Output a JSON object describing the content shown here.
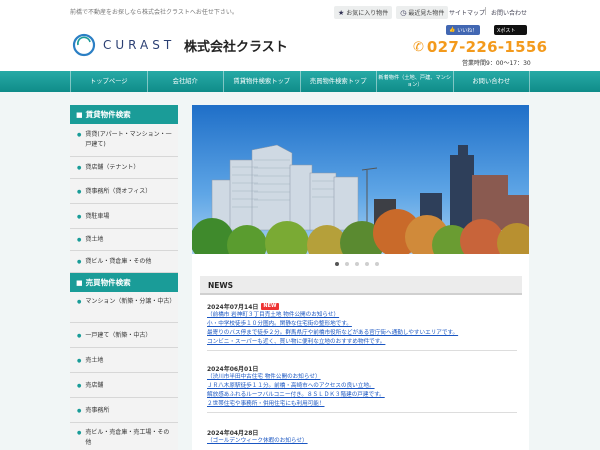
{
  "topbar": {
    "tagline": "前橋で不動産をお探しなら株式会社クラストへお任せ下さい。",
    "favorites": "お気に入り物件",
    "recent": "最近見た物件",
    "sitemap": "サイトマップ",
    "contact": "お問い合わせ"
  },
  "header": {
    "logo_en": "CURAST",
    "logo_jp": "株式会社クラスト",
    "facebook": "いいね！",
    "twitter": "Xポスト",
    "phone": "027-226-1556",
    "hours": "営業時間9：00～17：30"
  },
  "nav": [
    {
      "label": "トップページ"
    },
    {
      "label": "会社紹介"
    },
    {
      "label": "賃貸物件検索トップ"
    },
    {
      "label": "売買物件検索トップ"
    },
    {
      "label": "新着物件（土地、戸建、マンション）"
    },
    {
      "label": "お問い合わせ"
    }
  ],
  "sidebar": {
    "rental_title": "賃貸物件検索",
    "rental_items": [
      {
        "label": "賃貸(アパート・マンション・一戸建て)"
      },
      {
        "label": "貸店舗（テナント）"
      },
      {
        "label": "貸事務所（貸オフィス）"
      },
      {
        "label": "貸駐車場"
      },
      {
        "label": "貸土地"
      },
      {
        "label": "貸ビル・貸倉庫・その他"
      }
    ],
    "sale_title": "売買物件検索",
    "sale_items": [
      {
        "label": "マンション（新築・分譲・中古）"
      },
      {
        "label": "一戸建て（新築・中古）"
      },
      {
        "label": "売土地"
      },
      {
        "label": "売店舗"
      },
      {
        "label": "売事務所"
      },
      {
        "label": "売ビル・売倉庫・売工場・その他"
      }
    ]
  },
  "news": {
    "heading": "NEWS",
    "new_badge": "NEW",
    "items": [
      {
        "date": "2024年07月14日",
        "lines": [
          "（前橋市 岩神町３丁目売土地 物件公開のお知らせ）",
          "小・中学校徒歩１０分圏内。閑静な住宅街の整形地です。",
          "最寄りのバス停まで徒歩２分。群馬県庁や前橋市役所などがある官庁街へ通勤しやすいエリアです。",
          "コンビニ・スーパーも近く、買い物に便利な立地のおすすめ物件です。"
        ]
      },
      {
        "date": "2024年06月01日",
        "lines": [
          "（渋川市半田中古住宅 物件公開のお知らせ）",
          "ＪＲ八木原駅徒歩１１分。前橋・高崎市へのアクセスの良い立地。",
          "解放感あふれるルーフバルコニー付き。８ＳＬＤＫ３階建の戸建です。",
          "２世帯住宅や事務所・併用住宅にも利用可能！"
        ]
      },
      {
        "date": "2024年04月28日",
        "lines": [
          "（ゴールデンウィーク休暇のお知らせ）"
        ]
      }
    ]
  },
  "colors": {
    "accent": "#1a9c98",
    "phone": "#f39a1c",
    "link": "#1a56c2"
  }
}
